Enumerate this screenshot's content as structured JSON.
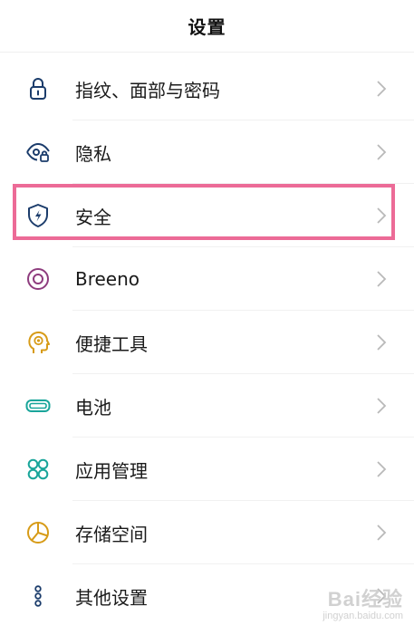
{
  "header": {
    "title": "设置"
  },
  "settings": {
    "items": [
      {
        "label": "指纹、面部与密码",
        "icon": "lock-icon",
        "color": "#1b3c6b"
      },
      {
        "label": "隐私",
        "icon": "privacy-eye-icon",
        "color": "#1b3c6b"
      },
      {
        "label": "安全",
        "icon": "security-shield-icon",
        "color": "#1b3c6b"
      },
      {
        "label": "Breeno",
        "icon": "breeno-circle-icon",
        "color": "#8e3c7e"
      },
      {
        "label": "便捷工具",
        "icon": "head-gear-icon",
        "color": "#d79b17"
      },
      {
        "label": "电池",
        "icon": "battery-icon",
        "color": "#19a59a"
      },
      {
        "label": "应用管理",
        "icon": "apps-grid-icon",
        "color": "#19a59a"
      },
      {
        "label": "存储空间",
        "icon": "storage-pie-icon",
        "color": "#d79b17"
      },
      {
        "label": "其他设置",
        "icon": "more-dots-icon",
        "color": "#1b3c6b"
      }
    ]
  },
  "highlight": {
    "target": "安全",
    "color": "#ec6b97"
  },
  "watermark": {
    "main": "Bai经验",
    "sub": "jingyan.baidu.com"
  }
}
